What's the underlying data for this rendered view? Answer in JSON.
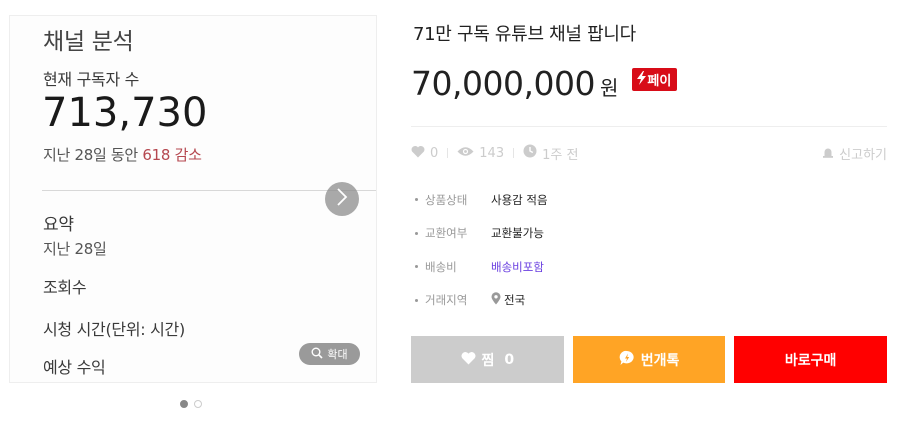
{
  "image": {
    "title": "채널 분석",
    "subscriber_label": "현재 구독자 수",
    "subscriber_count": "713,730",
    "change_prefix": "지난 28일 동안 ",
    "change_value": "618 감소",
    "summary_label": "요약",
    "summary_period": "지난 28일",
    "metric_views": "조회수",
    "metric_watch": "시청 시간(단위: 시간)",
    "metric_revenue": "예상 수익",
    "zoom_label": "확대",
    "dot_count": 2,
    "active_dot": 0
  },
  "product": {
    "title": "71만 구독 유튜브 채널 팝니다",
    "price": "70,000,000",
    "currency": "원",
    "pay_badge": "페이"
  },
  "stats": {
    "likes": "0",
    "views": "143",
    "time": "1주 전",
    "report": "신고하기"
  },
  "specs": [
    {
      "key": "상품상태",
      "value": "사용감 적음"
    },
    {
      "key": "교환여부",
      "value": "교환불가능"
    },
    {
      "key": "배송비",
      "value": "배송비포함"
    },
    {
      "key": "거래지역",
      "value": "전국"
    }
  ],
  "actions": {
    "like_label": "찜",
    "like_count": "0",
    "chat_label": "번개톡",
    "buy_label": "바로구매"
  },
  "colors": {
    "pay_badge": "#d80c18",
    "chat_button": "#ffa425",
    "buy_button": "#ff0000",
    "like_button": "#cccccc",
    "shipping_link": "#6a3fe0",
    "decrease_text": "#b5474f"
  }
}
